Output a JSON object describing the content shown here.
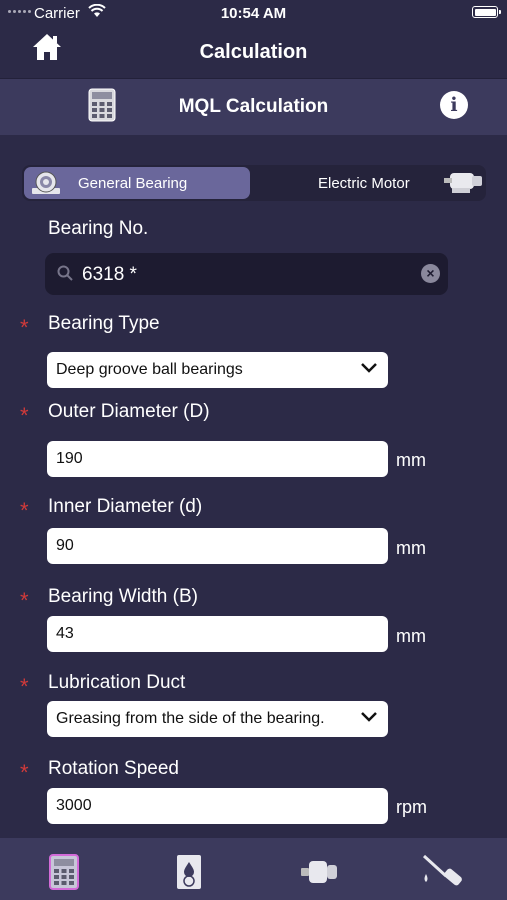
{
  "status_bar": {
    "carrier": "Carrier",
    "time": "10:54 AM"
  },
  "nav": {
    "title": "Calculation",
    "home_icon": "home-icon"
  },
  "subheader": {
    "title": "MQL Calculation",
    "left_icon": "calculator-icon",
    "right_icon": "info-icon"
  },
  "segment": {
    "general_label": "General Bearing",
    "motor_label": "Electric Motor",
    "selected": "General Bearing"
  },
  "form": {
    "bearing_no_label": "Bearing No.",
    "bearing_no_value": "6318 *",
    "bearing_type_label": "Bearing Type",
    "bearing_type_value": "Deep groove ball bearings",
    "outer_label": "Outer Diameter (D)",
    "outer_value": "190",
    "inner_label": "Inner Diameter (d)",
    "inner_value": "90",
    "width_label": "Bearing Width (B)",
    "width_value": "43",
    "duct_label": "Lubrication Duct",
    "duct_value": "Greasing from the side of the bearing.",
    "speed_label": "Rotation Speed",
    "speed_value": "3000",
    "unit_mm": "mm",
    "unit_rpm": "rpm",
    "required_mark": "*"
  },
  "tabs": [
    "calculator-tab-icon",
    "lubricant-tab-icon",
    "motor-tab-icon",
    "grease-gun-tab-icon"
  ],
  "colors": {
    "background": "#2c2a47",
    "header": "#3c3a5d",
    "segment_selected": "#6a679b",
    "required": "#d03a3a"
  }
}
